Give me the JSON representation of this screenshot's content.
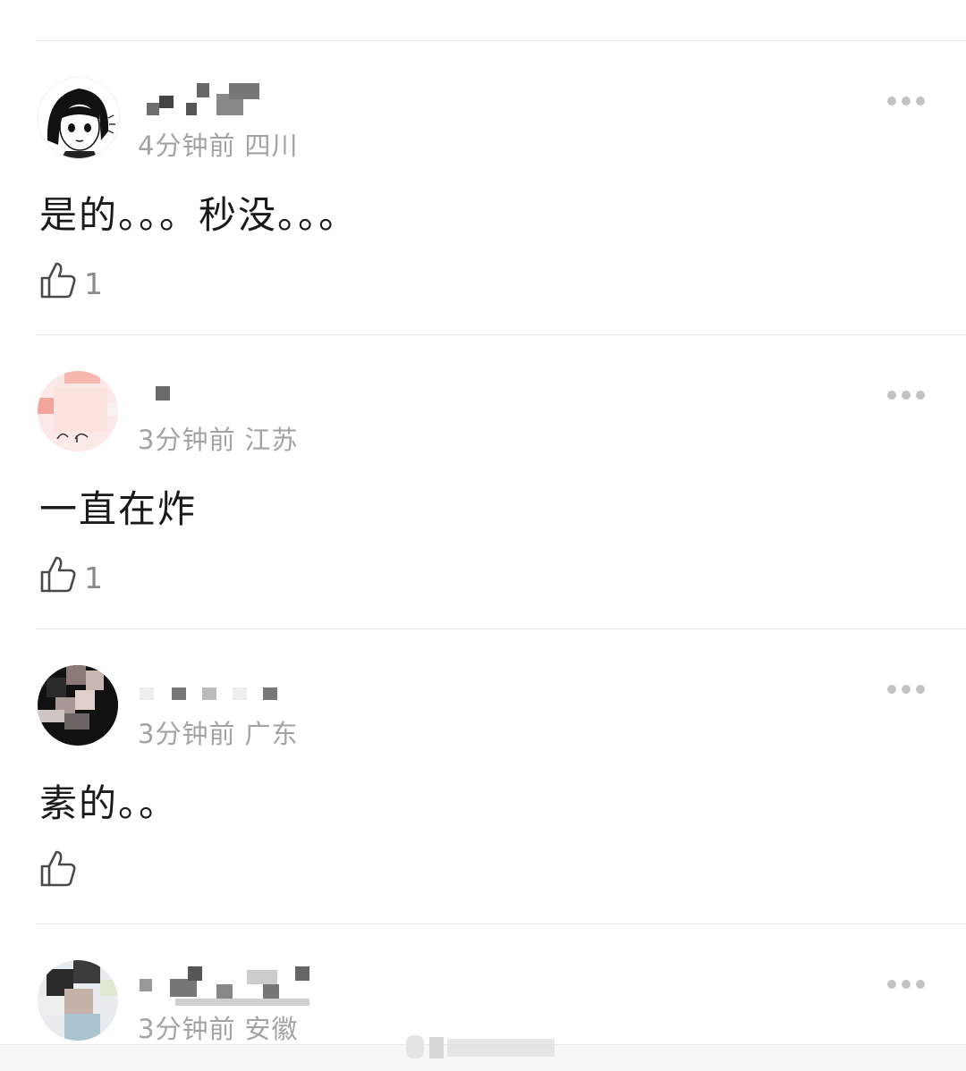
{
  "top_stub": {
    "char": ""
  },
  "comments": [
    {
      "time": "4分钟前",
      "location": "四川",
      "text": "是的。。。秒没。。。",
      "like_count": "1"
    },
    {
      "time": "3分钟前",
      "location": "江苏",
      "text": "一直在炸",
      "like_count": "1"
    },
    {
      "time": "3分钟前",
      "location": "广东",
      "text": "素的。。",
      "like_count": ""
    },
    {
      "time": "3分钟前",
      "location": "安徽",
      "text": "",
      "like_count": ""
    }
  ],
  "icons": {
    "more": "more-horizontal-icon",
    "like": "thumbs-up-icon"
  },
  "colors": {
    "meta_text": "#a3a3a3",
    "body_text": "#1a1a1a",
    "divider": "#e6e6e6"
  }
}
